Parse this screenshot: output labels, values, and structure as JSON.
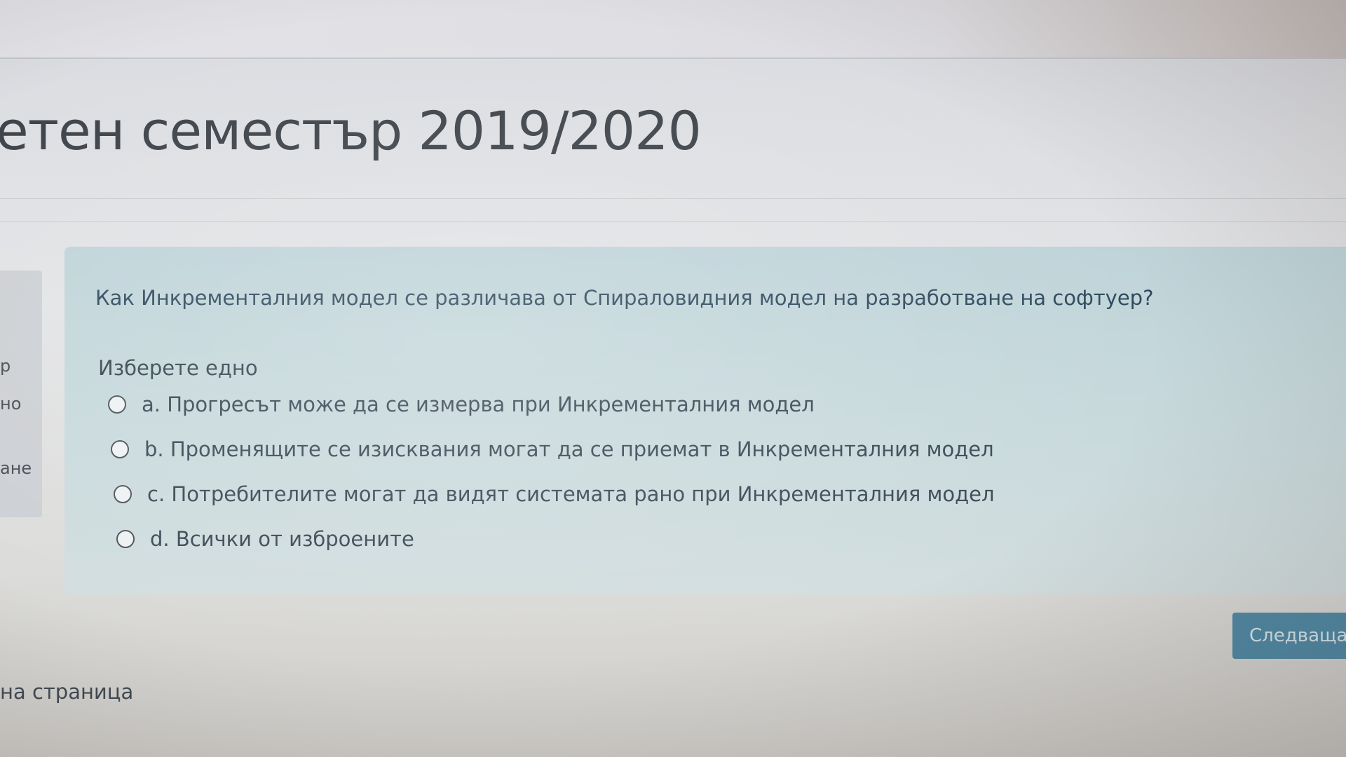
{
  "page": {
    "title": "етен семестър 2019/2020"
  },
  "sidebar": {
    "labels": [
      "р",
      "но",
      "ане"
    ]
  },
  "question": {
    "text": "Как Инкременталния модел се различава от Спираловидния модел на разработване на софтуер?",
    "prompt": "Изберете едно",
    "answers": [
      {
        "label": "a. Прогресът може да се измерва при Инкременталния модел",
        "selected": false
      },
      {
        "label": "b. Променящите се изисквания могат да се приемат в Инкременталния модел",
        "selected": false
      },
      {
        "label": "c. Потребителите могат да видят системата рано при Инкременталния модел",
        "selected": false
      },
      {
        "label": "d. Всички от изброените",
        "selected": false
      }
    ]
  },
  "navigation": {
    "next_label": "Следваща с",
    "page_link_label": "на страница"
  },
  "colors": {
    "card_background": "#c9dadd",
    "question_text": "#2f4a5e",
    "next_button": "#4f8aa6"
  }
}
